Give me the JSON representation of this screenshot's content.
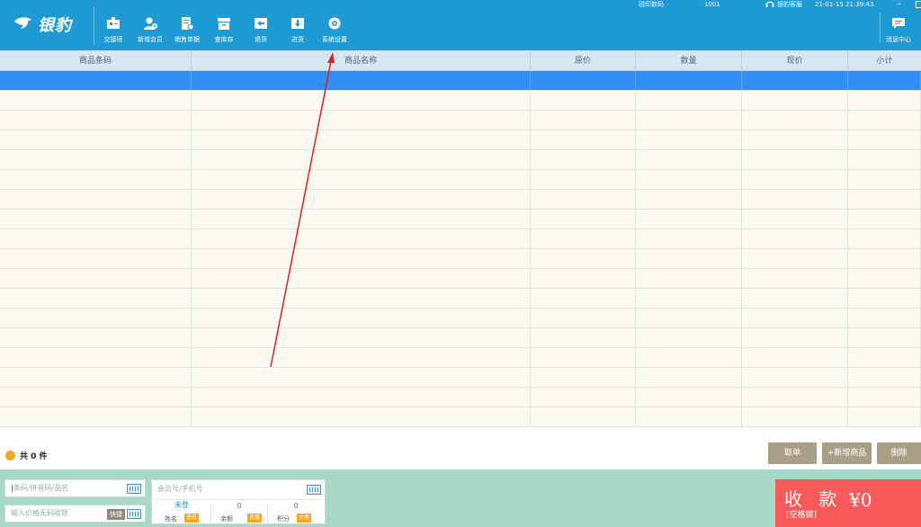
{
  "app": {
    "name": "银豹"
  },
  "status_bar": {
    "printer_label": "锐印数码",
    "terminal_no": "1001",
    "support_label": "银豹客服",
    "datetime": "21-01-15 21:39:43"
  },
  "toolbar": [
    {
      "icon": "shift-handover-icon",
      "label": "交接班"
    },
    {
      "icon": "add-member-icon",
      "label": "新增会员"
    },
    {
      "icon": "sales-receipt-icon",
      "label": "销售单据"
    },
    {
      "icon": "inventory-icon",
      "label": "查库存"
    },
    {
      "icon": "return-goods-icon",
      "label": "退货"
    },
    {
      "icon": "receive-goods-icon",
      "label": "进货"
    },
    {
      "icon": "settings-icon",
      "label": "系统设置"
    }
  ],
  "message_center": {
    "label": "消息中心"
  },
  "table": {
    "columns": [
      "商品条码",
      "商品名称",
      "原价",
      "数量",
      "现价",
      "小计"
    ],
    "rows": [
      {
        "barcode": "",
        "name": "",
        "orig_price": "",
        "qty": "",
        "price": "",
        "subtotal": ""
      }
    ]
  },
  "summary": {
    "count_text": "共 0 件",
    "buttons": [
      "取单",
      "+新增商品",
      "删除"
    ]
  },
  "inputs": {
    "barcode_placeholder": "条码/拼音码/品名",
    "nobarcode_placeholder": "输入价格无码收银",
    "nobarcode_tag": "快捷",
    "member_placeholder": "会员号/手机号"
  },
  "member_info": {
    "name_value": "未登",
    "name_label": "姓名",
    "name_tag": "签名",
    "balance_value": "0",
    "balance_label": "余额",
    "balance_tag": "充值",
    "points_value": "0",
    "points_label": "积分",
    "points_tag": "兑换"
  },
  "checkout": {
    "title": "收 款",
    "key_hint": "[空格键]",
    "amount": "¥0"
  },
  "colors": {
    "topbar": "#1e9ad4",
    "selected_row": "#2f8ff5",
    "pay_button": "#f85a5a",
    "bottom_bg": "#a8d8c8",
    "gray_button": "#a89f86",
    "annotation_arrow": "#e02020"
  }
}
